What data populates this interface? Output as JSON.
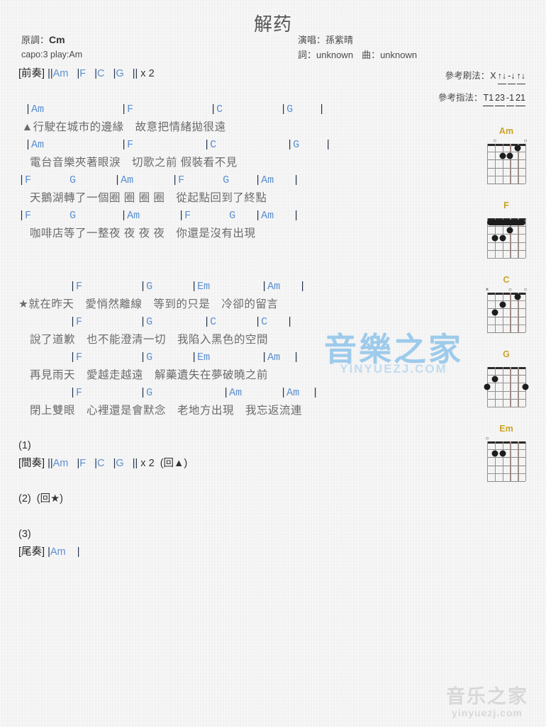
{
  "title": "解药",
  "meta_left": {
    "original_key_label": "原調：",
    "original_key_value": "Cm",
    "capo_play": "capo:3 play:Am"
  },
  "meta_right": {
    "singer_label": "演唱：",
    "singer_value": "孫紫晴",
    "lyricist_label": "詞：",
    "lyricist_value": "unknown",
    "composer_label": "曲：",
    "composer_value": "unknown",
    "strum_label": "參考刷法：",
    "strum_tokens": [
      {
        "text": "X",
        "underline": false
      },
      {
        "text": "↑↓",
        "underline": true
      },
      {
        "text": "-↓",
        "underline": true
      },
      {
        "text": "↑↓",
        "underline": true
      }
    ],
    "fingerstyle_label": "參考指法：",
    "fingerstyle_tokens": [
      {
        "text": "T1",
        "underline": true
      },
      {
        "text": "23",
        "underline": true
      },
      {
        "text": "-1",
        "underline": true
      },
      {
        "text": "21",
        "underline": true
      }
    ]
  },
  "sheet": [
    {
      "type": "section",
      "text": "[前奏] ||Am   |F   |C   |G   || x 2"
    },
    {
      "type": "spacer"
    },
    {
      "type": "chords",
      "text": " |Am            |F            |C         |G    |"
    },
    {
      "type": "lyrics",
      "text": " ▲行駛在城市的邊緣　故意把情緒拋很遠"
    },
    {
      "type": "chords",
      "text": " |Am            |F           |C           |G    |"
    },
    {
      "type": "lyrics",
      "text": "　電台音樂夾著眼淚　切歌之前 假裝看不見"
    },
    {
      "type": "chords",
      "text": "|F      G      |Am      |F      G    |Am   |"
    },
    {
      "type": "lyrics",
      "text": "　天鵝湖轉了一個圈 圈 圈 圈　從起點回到了終點"
    },
    {
      "type": "chords",
      "text": "|F      G       |Am      |F      G   |Am   |"
    },
    {
      "type": "lyrics",
      "text": "　咖啡店等了一整夜 夜 夜 夜　你還是沒有出現"
    },
    {
      "type": "spacer"
    },
    {
      "type": "spacer"
    },
    {
      "type": "chords",
      "text": "        |F         |G      |Em        |Am   |"
    },
    {
      "type": "lyrics",
      "text": "★就在昨天　愛悄然離線　等到的只是　冷卻的留言"
    },
    {
      "type": "chords",
      "text": "        |F         |G        |C      |C   |"
    },
    {
      "type": "lyrics",
      "text": "　說了道歉　也不能澄清一切　我陷入黑色的空間"
    },
    {
      "type": "chords",
      "text": "        |F         |G      |Em        |Am  |"
    },
    {
      "type": "lyrics",
      "text": "　再見雨天　愛越走越遠　解藥遺失在夢破曉之前"
    },
    {
      "type": "chords",
      "text": "        |F         |G           |Am      |Am  |"
    },
    {
      "type": "lyrics",
      "text": "　閉上雙眼　心裡還是會默念　老地方出現　我忘返流連"
    },
    {
      "type": "spacer"
    },
    {
      "type": "section",
      "text": "(1)"
    },
    {
      "type": "section",
      "text": "[間奏] ||Am   |F   |C   |G   || x 2  (回▲)"
    },
    {
      "type": "spacer"
    },
    {
      "type": "section",
      "text": "(2)  (回★)"
    },
    {
      "type": "spacer"
    },
    {
      "type": "section",
      "text": "(3)"
    },
    {
      "type": "section",
      "text": "[尾奏] |Am    |"
    }
  ],
  "diagrams": [
    {
      "name": "Am",
      "markers": [
        {
          "symbol": "○",
          "string": 5
        },
        {
          "symbol": "○",
          "string": 1
        }
      ],
      "dots": [
        {
          "string": 2,
          "fret": 1
        },
        {
          "string": 4,
          "fret": 2
        },
        {
          "string": 3,
          "fret": 2
        }
      ],
      "barre": null
    },
    {
      "name": "F",
      "markers": [],
      "dots": [
        {
          "string": 3,
          "fret": 2
        },
        {
          "string": 5,
          "fret": 3
        },
        {
          "string": 4,
          "fret": 3
        }
      ],
      "barre": {
        "fret": 1,
        "from_string": 6,
        "to_string": 1
      }
    },
    {
      "name": "C",
      "markers": [
        {
          "symbol": "×",
          "string": 6
        },
        {
          "symbol": "○",
          "string": 3
        },
        {
          "symbol": "○",
          "string": 1
        }
      ],
      "dots": [
        {
          "string": 2,
          "fret": 1
        },
        {
          "string": 4,
          "fret": 2
        },
        {
          "string": 5,
          "fret": 3
        }
      ],
      "barre": null
    },
    {
      "name": "G",
      "markers": [],
      "dots": [
        {
          "string": 5,
          "fret": 2
        },
        {
          "string": 6,
          "fret": 3
        },
        {
          "string": 1,
          "fret": 3
        }
      ],
      "barre": null
    },
    {
      "name": "Em",
      "markers": [
        {
          "symbol": "○",
          "string": 6
        }
      ],
      "dots": [
        {
          "string": 5,
          "fret": 2
        },
        {
          "string": 4,
          "fret": 2
        }
      ],
      "barre": null
    }
  ],
  "watermark_center": {
    "cn": "音樂之家",
    "en": "YINYUEZJ.COM"
  },
  "watermark_bottom": {
    "cn": "音乐之家",
    "en": "yinyuezj.com"
  },
  "colors": {
    "chord_blue": "#5b8fd0",
    "lyric_gray": "#6a6a6a",
    "diagram_label": "#c9a227",
    "watermark_blue": "#8fc4ea",
    "watermark_gray": "#d8d8d8"
  }
}
